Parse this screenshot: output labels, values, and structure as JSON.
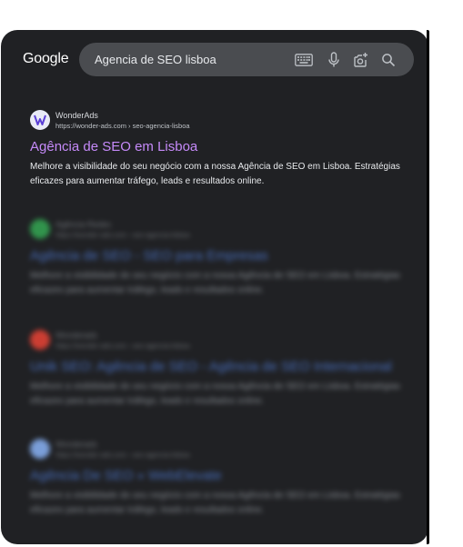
{
  "header": {
    "logo": "Google",
    "search_query": "Agencia de SEO lisboa",
    "icons": [
      "keyboard-icon",
      "microphone-icon",
      "lens-camera-icon",
      "search-icon"
    ]
  },
  "results": [
    {
      "site_name": "WonderAds",
      "url": "https://wonder-ads.com › seo-agencia-lisboa",
      "title": "Agência de SEO em Lisboa",
      "snippet": "Melhore a visibilidade do seu negócio com a nossa Agência de SEO em Lisboa. Estratégias eficazes para aumentar tráfego, leads e resultados online.",
      "favicon_color": "#e8eaf6"
    },
    {
      "site_name": "Agência Redes",
      "url": "https://wonder-ads.com › seo-agencia-lisboa",
      "title": "Agência de SEO - SEO para Empresas",
      "snippet": "Melhore a visibilidade do seu negócio com a nossa Agência de SEO em Lisboa. Estratégias eficazes para aumentar tráfego, leads e resultados online.",
      "favicon_color": "#34a853"
    },
    {
      "site_name": "Wonderads",
      "url": "https://wonder-ads.com › seo-agencia-lisboa",
      "title": "Unik SEO: Agência de SEO - Agência de SEO Internacional",
      "snippet": "Melhore a visibilidade do seu negócio com a nossa Agência de SEO em Lisboa. Estratégias eficazes para aumentar tráfego, leads e resultados online.",
      "favicon_color": "#ea4335"
    },
    {
      "site_name": "Wonderads",
      "url": "https://wonder-ads.com › seo-agencia-lisboa",
      "title": "Agência De SEO » WebElevate",
      "snippet": "Melhore a visibilidade do seu negócio com a nossa Agência de SEO em Lisboa. Estratégias eficazes para aumentar tráfego, leads e resultados online.",
      "favicon_color": "#8ab4f8"
    }
  ]
}
